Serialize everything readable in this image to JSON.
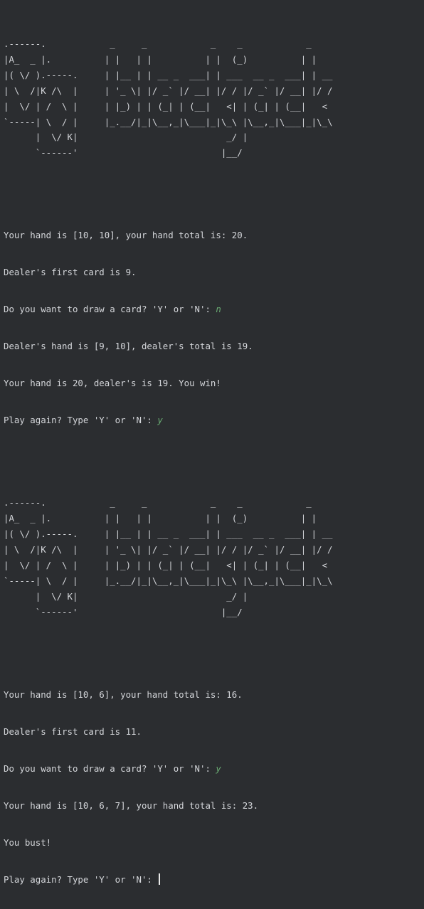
{
  "art": {
    "banner": ".------.            _     _            _    _            _\n|A_  _ |.          | |   | |          | |  (_)          | |\n|( \\/ ).-----.     | |__ | | __ _  ___| | ___  __ _  ___| | __\n| \\  /|K /\\  |     | '_ \\| |/ _` |/ __| |/ / |/ _` |/ __| |/ /\n|  \\/ | /  \\ |     | |_) | | (_| | (__|   <| | (_| | (__|   <\n`-----| \\  / |     |_.__/|_|\\__,_|\\___|_|\\_\\ |\\__,_|\\___|_|\\_\\\n      |  \\/ K|                            _/ |\n      `------'                           |__/"
  },
  "rounds": [
    {
      "lines": [
        {
          "text": "Your hand is [10, 10], your hand total is: 20."
        },
        {
          "text": "Dealer's first card is 9."
        },
        {
          "text": "Do you want to draw a card? 'Y' or 'N': ",
          "input": "n"
        },
        {
          "text": "Dealer's hand is [9, 10], dealer's total is 19."
        },
        {
          "text": "Your hand is 20, dealer's is 19. You win!"
        },
        {
          "text": "Play again? Type 'Y' or 'N': ",
          "input": "y"
        }
      ]
    },
    {
      "lines": [
        {
          "text": "Your hand is [10, 6], your hand total is: 16."
        },
        {
          "text": "Dealer's first card is 11."
        },
        {
          "text": "Do you want to draw a card? 'Y' or 'N': ",
          "input": "y"
        },
        {
          "text": "Your hand is [10, 6, 7], your hand total is: 23."
        },
        {
          "text": "You bust!"
        },
        {
          "text": "Play again? Type 'Y' or 'N': "
        }
      ]
    }
  ]
}
